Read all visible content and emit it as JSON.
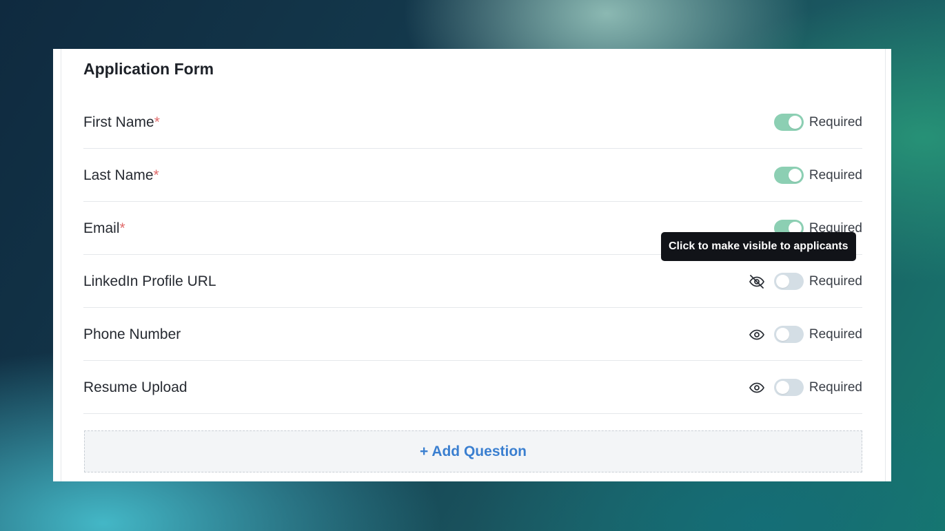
{
  "form": {
    "title": "Application Form",
    "required_label": "Required",
    "tooltip": "Click to make visible to applicants",
    "add_question": "+ Add Question",
    "fields": [
      {
        "label": "First Name",
        "asterisk": "*",
        "required": true,
        "visibility_icon": null
      },
      {
        "label": "Last Name",
        "asterisk": "*",
        "required": true,
        "visibility_icon": null
      },
      {
        "label": "Email",
        "asterisk": "*",
        "required": true,
        "visibility_icon": null
      },
      {
        "label": "LinkedIn Profile URL",
        "asterisk": "",
        "required": false,
        "visibility_icon": "eye-off-icon"
      },
      {
        "label": "Phone Number",
        "asterisk": "",
        "required": false,
        "visibility_icon": "eye-icon"
      },
      {
        "label": "Resume Upload",
        "asterisk": "",
        "required": false,
        "visibility_icon": "eye-icon"
      }
    ]
  },
  "colors": {
    "toggle_on": "#8ccfb3",
    "toggle_off": "#d4dee5",
    "asterisk": "#e06a6a",
    "add_question_text": "#3a7fd0",
    "tooltip_bg": "#111318"
  }
}
